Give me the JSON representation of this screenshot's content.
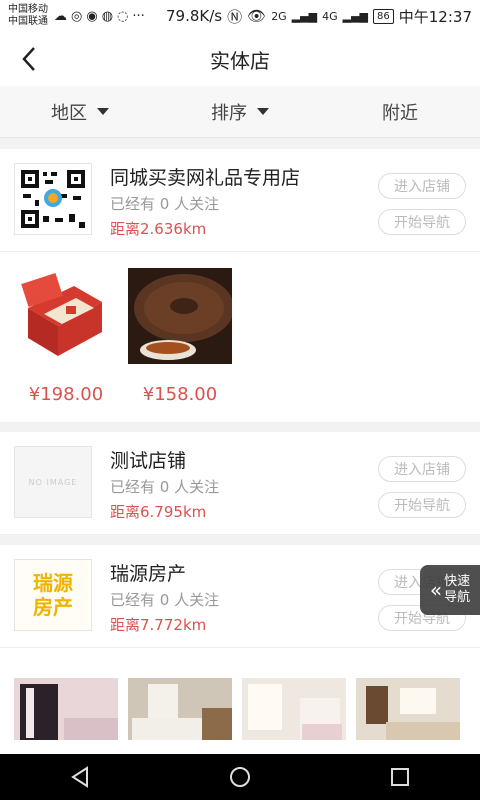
{
  "status_bar": {
    "carrier1": "中国移动",
    "carrier2": "中国联通",
    "speed": "79.8K/s",
    "net1": "2G",
    "net2": "4G",
    "battery": "86",
    "time": "中午12:37"
  },
  "header": {
    "title": "实体店"
  },
  "filters": [
    {
      "label": "地区",
      "has_caret": true
    },
    {
      "label": "排序",
      "has_caret": true
    },
    {
      "label": "附近",
      "has_caret": false
    }
  ],
  "stores": [
    {
      "name": "同城买卖网礼品专用店",
      "follow": "已经有 0 人关注",
      "distance": "距离2.636km",
      "enter_label": "进入店铺",
      "nav_label": "开始导航",
      "products": [
        {
          "price": "¥198.00"
        },
        {
          "price": "¥158.00"
        }
      ]
    },
    {
      "name": "测试店铺",
      "follow": "已经有 0 人关注",
      "distance": "距离6.795km",
      "enter_label": "进入店铺",
      "nav_label": "开始导航",
      "logo_text": "NO IMAGE"
    },
    {
      "name": "瑞源房产",
      "follow": "已经有 0 人关注",
      "distance": "距离7.772km",
      "enter_label": "进入店铺",
      "nav_label": "开始导航",
      "logo_text": "瑞源\n房产"
    }
  ],
  "quick_nav": {
    "line1": "快速",
    "line2": "导航"
  },
  "colors": {
    "accent": "#d9534f",
    "muted": "#999999",
    "logo_gold": "#f0b400"
  }
}
